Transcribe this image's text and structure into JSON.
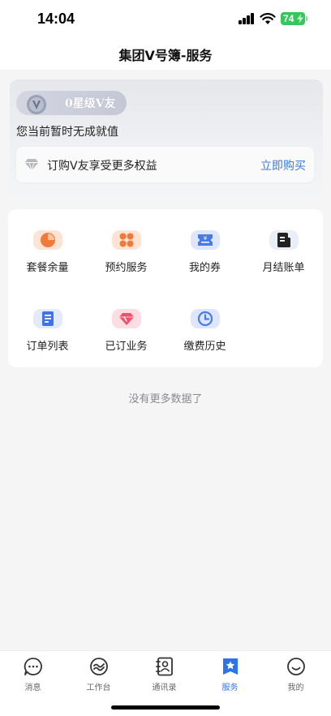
{
  "status_bar": {
    "time": "14:04",
    "battery": "74"
  },
  "nav": {
    "title": "集团V号簿-服务"
  },
  "member": {
    "level_badge": "0星级V友",
    "subtitle": "您当前暂时无成就值",
    "promo_text": "订购V友享受更多权益",
    "promo_link": "立即购买"
  },
  "services": [
    {
      "label": "套餐余量",
      "icon": "pie-chart-icon",
      "bg": "#fde3d4",
      "color": "#f07a3a"
    },
    {
      "label": "预约服务",
      "icon": "grid-apps-icon",
      "bg": "#fde3d4",
      "color": "#f07a3a"
    },
    {
      "label": "我的券",
      "icon": "coupon-icon",
      "bg": "#dde6fb",
      "color": "#4a7ae6"
    },
    {
      "label": "月结账单",
      "icon": "bill-icon",
      "bg": "#e9eef7",
      "color": "#222222"
    },
    {
      "label": "订单列表",
      "icon": "document-icon",
      "bg": "#e3ebfb",
      "color": "#3f74e6"
    },
    {
      "label": "已订业务",
      "icon": "gem-icon",
      "bg": "#fbdde3",
      "color": "#f0506a"
    },
    {
      "label": "缴费历史",
      "icon": "clock-icon",
      "bg": "#dde6fb",
      "color": "#4a7ae6"
    }
  ],
  "no_more_text": "没有更多数据了",
  "tabs": [
    {
      "label": "消息",
      "icon": "message-icon",
      "active": false
    },
    {
      "label": "工作台",
      "icon": "workbench-icon",
      "active": false
    },
    {
      "label": "通讯录",
      "icon": "contacts-icon",
      "active": false
    },
    {
      "label": "服务",
      "icon": "service-star-icon",
      "active": true
    },
    {
      "label": "我的",
      "icon": "profile-smile-icon",
      "active": false
    }
  ],
  "colors": {
    "accent": "#2f74e6",
    "link": "#3a7be0",
    "battery": "#34c759"
  }
}
